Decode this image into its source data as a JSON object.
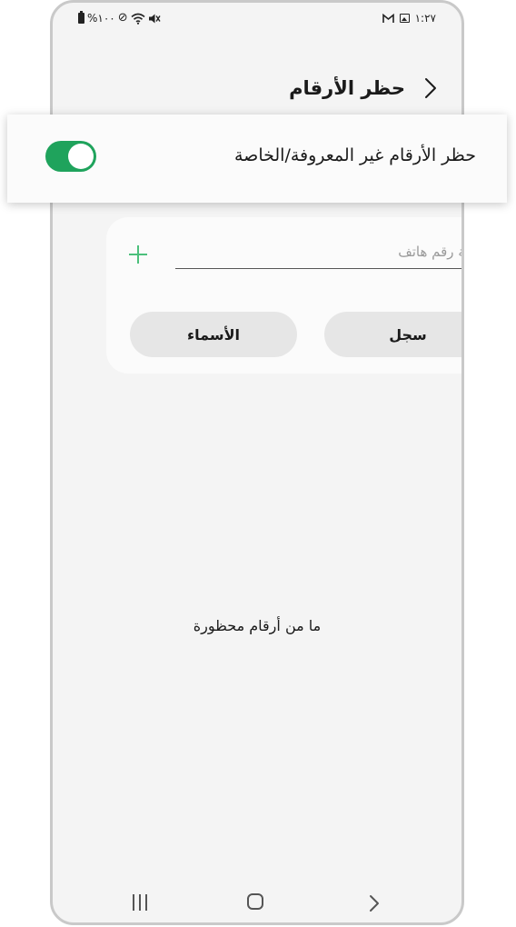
{
  "status_bar": {
    "battery_text": "%١٠٠",
    "time": "١:٢٧",
    "icons": [
      "battery-icon",
      "do-not-disturb-icon",
      "wifi-icon",
      "mute-icon",
      "gmail-icon",
      "gallery-icon"
    ]
  },
  "header": {
    "title": "حظر الأرقام",
    "back_icon": "chevron-icon"
  },
  "block_unknown": {
    "label": "حظر الأرقام غير المعروفة/الخاصة",
    "enabled": true,
    "accent_color": "#1fa35c"
  },
  "add_number": {
    "placeholder": "إضافة رقم هاتف",
    "value": "",
    "add_icon": "plus-icon",
    "accent_color": "#4cc07c"
  },
  "buttons": {
    "log_label": "سجل",
    "contacts_label": "الأسماء"
  },
  "empty_state": {
    "text": "ما من أرقام محظورة"
  },
  "nav_bar": {
    "icons": [
      "recents-icon",
      "home-icon",
      "back-icon"
    ]
  }
}
